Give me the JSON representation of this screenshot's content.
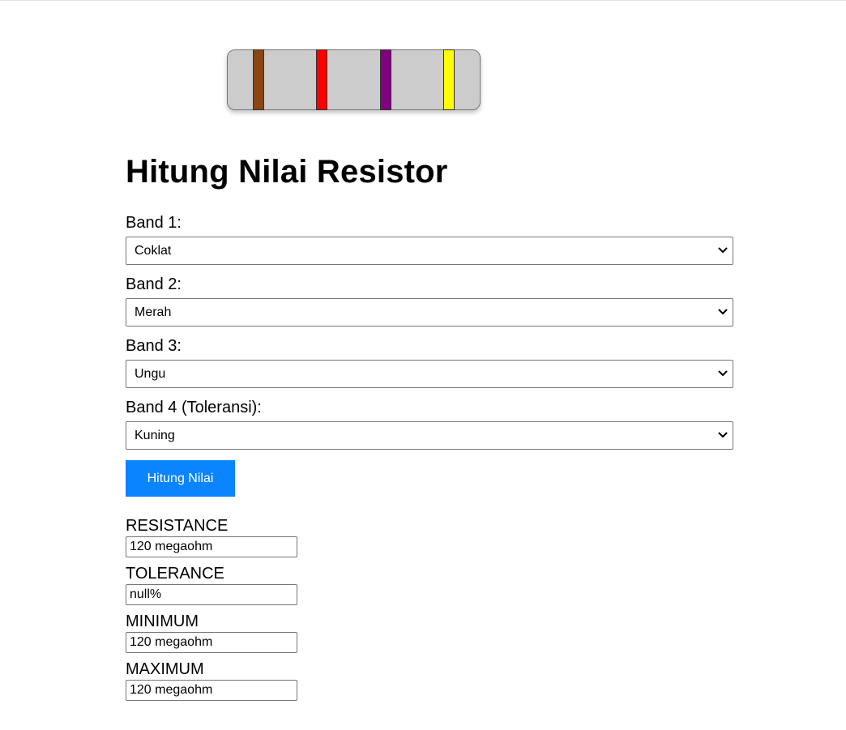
{
  "resistor": {
    "bands": [
      {
        "color_name": "Coklat",
        "hex": "#8b4513"
      },
      {
        "color_name": "Merah",
        "hex": "#ff0000"
      },
      {
        "color_name": "Ungu",
        "hex": "#800080"
      },
      {
        "color_name": "Kuning",
        "hex": "#ffff00"
      }
    ],
    "body_color": "#cccccc"
  },
  "title": "Hitung Nilai Resistor",
  "form": {
    "band1": {
      "label": "Band 1:",
      "selected": "Coklat"
    },
    "band2": {
      "label": "Band 2:",
      "selected": "Merah"
    },
    "band3": {
      "label": "Band 3:",
      "selected": "Ungu"
    },
    "band4": {
      "label": "Band 4 (Toleransi):",
      "selected": "Kuning"
    },
    "button_label": "Hitung Nilai",
    "button_color": "#0a84ff"
  },
  "results": {
    "resistance": {
      "label": "RESISTANCE",
      "value": "120 megaohm"
    },
    "tolerance": {
      "label": "TOLERANCE",
      "value": "null%"
    },
    "minimum": {
      "label": "MINIMUM",
      "value": "120 megaohm"
    },
    "maximum": {
      "label": "MAXIMUM",
      "value": "120 megaohm"
    }
  }
}
